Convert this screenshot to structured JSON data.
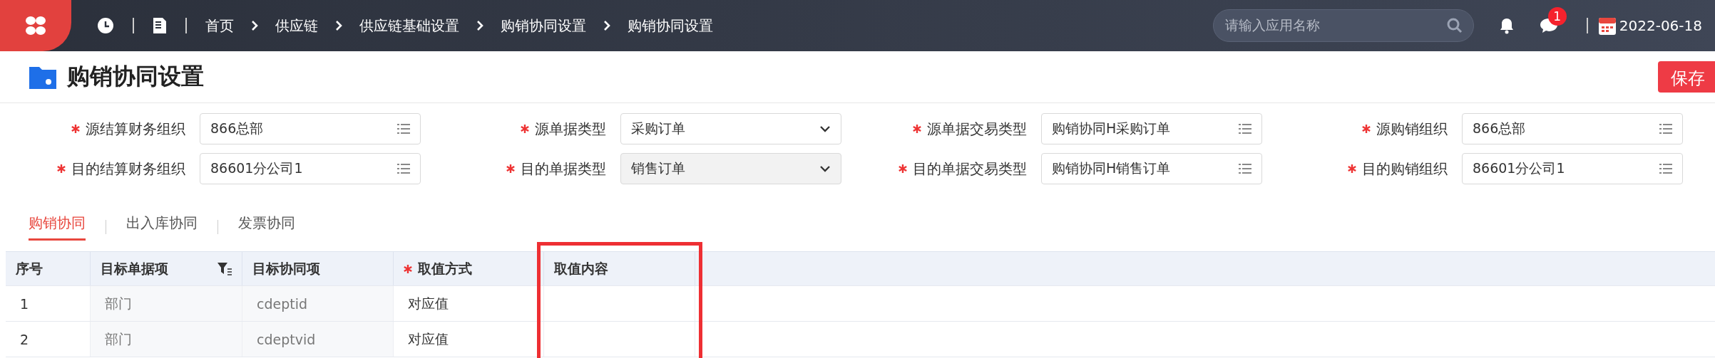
{
  "topbar": {
    "breadcrumbs": [
      "首页",
      "供应链",
      "供应链基础设置",
      "购销协同设置",
      "购销协同设置"
    ],
    "search": {
      "placeholder": "请输入应用名称"
    },
    "message_badge": "1",
    "date": "2022-06-18"
  },
  "page": {
    "title": "购销协同设置",
    "save_button": "保存"
  },
  "form": [
    {
      "label": "源结算财务组织",
      "required": true,
      "kind": "lookup",
      "value": "866总部",
      "disabled": false
    },
    {
      "label": "源单据类型",
      "required": true,
      "kind": "select",
      "value": "采购订单",
      "disabled": false
    },
    {
      "label": "源单据交易类型",
      "required": true,
      "kind": "lookup",
      "value": "购销协同H采购订单",
      "disabled": false
    },
    {
      "label": "源购销组织",
      "required": true,
      "kind": "lookup",
      "value": "866总部",
      "disabled": false
    },
    {
      "label": "目的结算财务组织",
      "required": true,
      "kind": "lookup",
      "value": "86601分公司1",
      "disabled": false
    },
    {
      "label": "目的单据类型",
      "required": true,
      "kind": "select",
      "value": "销售订单",
      "disabled": true
    },
    {
      "label": "目的单据交易类型",
      "required": true,
      "kind": "lookup",
      "value": "购销协同H销售订单",
      "disabled": false
    },
    {
      "label": "目的购销组织",
      "required": true,
      "kind": "lookup",
      "value": "86601分公司1",
      "disabled": false
    }
  ],
  "tabs": [
    {
      "label": "购销协同",
      "selected": true
    },
    {
      "label": "出入库协同",
      "selected": false
    },
    {
      "label": "发票协同",
      "selected": false
    }
  ],
  "table": {
    "columns": [
      {
        "label": "序号",
        "required": false,
        "filter": false,
        "readonly": false,
        "highlighted": false
      },
      {
        "label": "目标单据项",
        "required": false,
        "filter": true,
        "readonly": true,
        "highlighted": false
      },
      {
        "label": "目标协同项",
        "required": false,
        "filter": false,
        "readonly": true,
        "highlighted": false
      },
      {
        "label": "取值方式",
        "required": true,
        "filter": false,
        "readonly": false,
        "highlighted": false
      },
      {
        "label": "取值内容",
        "required": false,
        "filter": false,
        "readonly": false,
        "highlighted": true
      }
    ],
    "rows": [
      [
        "1",
        "部门",
        "cdeptid",
        "对应值"
      ],
      [
        "2",
        "部门",
        "cdeptvid",
        "对应值"
      ]
    ]
  }
}
